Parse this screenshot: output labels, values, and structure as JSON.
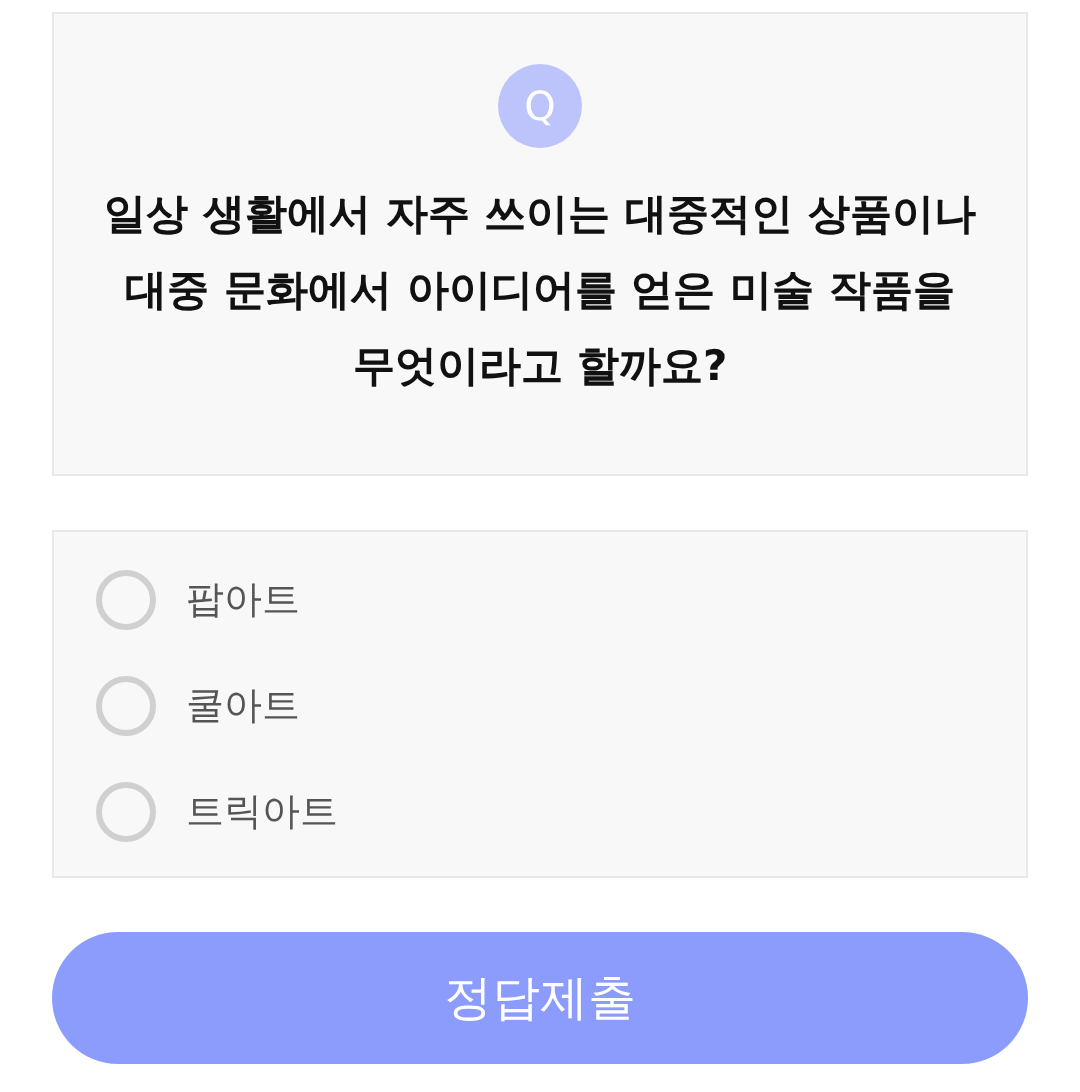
{
  "question": {
    "badge": "Q",
    "text": "일상 생활에서 자주 쓰이는 대중적인 상품이나 대중 문화에서 아이디어를 얻은 미술 작품을 무엇이라고 할까요?"
  },
  "options": [
    {
      "label": "팝아트",
      "selected": false
    },
    {
      "label": "쿨아트",
      "selected": false
    },
    {
      "label": "트릭아트",
      "selected": false
    }
  ],
  "submit": {
    "label": "정답제출"
  }
}
